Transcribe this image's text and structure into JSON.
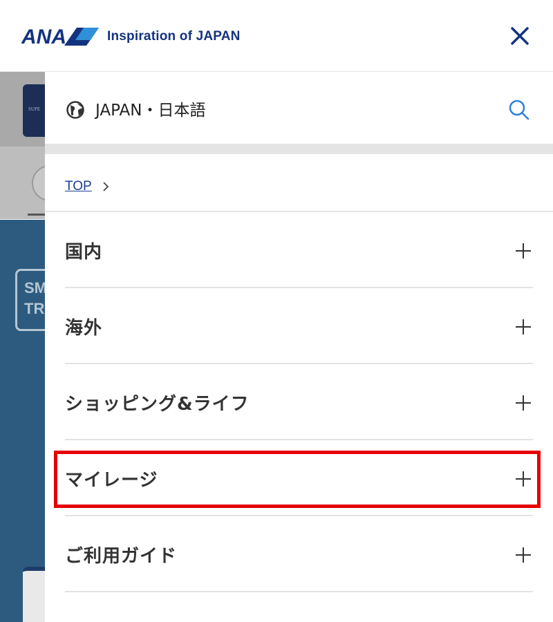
{
  "header": {
    "logo_text": "ANA",
    "tagline": "Inspiration of JAPAN",
    "close_icon": "close-icon"
  },
  "background": {
    "card_text": "SUPE",
    "smart_text": "SM\nTRA"
  },
  "drawer": {
    "language_label": "JAPAN・日本語",
    "breadcrumb": "TOP",
    "menu_items": [
      {
        "label": "国内"
      },
      {
        "label": "海外"
      },
      {
        "label": "ショッピング&ライフ"
      },
      {
        "label": "マイレージ"
      },
      {
        "label": "ご利用ガイド"
      }
    ]
  },
  "colors": {
    "brand_navy": "#13337e",
    "link_blue": "#1a3c8f",
    "search_blue": "#2f7fd6",
    "highlight_red": "#e60000",
    "background_blue": "#2d5b7f"
  }
}
